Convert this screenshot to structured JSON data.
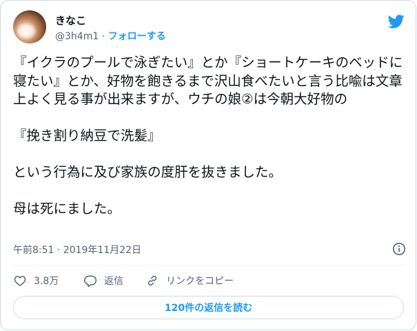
{
  "user": {
    "display_name": "きなこ",
    "handle": "@3h4m1",
    "separator": "·",
    "follow_label": "フォローする"
  },
  "tweet": {
    "text": "『イクラのプールで泳ぎたい』とか『ショートケーキのベッドに寝たい』とか、好物を飽きるまで沢山食べたいと言う比喩は文章上よく見る事が出来ますが、ウチの娘②は今朝大好物の\n\n『挽き割り納豆で洗髪』\n\nという行為に及び家族の度肝を抜きました。\n\n母は死にました。",
    "timestamp": "午前8:51 · 2019年11月22日"
  },
  "actions": {
    "like_count": "3.8万",
    "reply_label": "返信",
    "copy_link_label": "リンクをコピー"
  },
  "read_replies_label": "120件の返信を読む",
  "colors": {
    "brand_blue": "#1d9bf0",
    "text_primary": "#0f1419",
    "text_secondary": "#536471",
    "border": "#cfd9de"
  },
  "icons": {
    "brand": "twitter-bird-icon",
    "info": "info-icon",
    "like": "heart-icon",
    "reply": "speech-bubble-icon",
    "copy_link": "link-icon"
  }
}
